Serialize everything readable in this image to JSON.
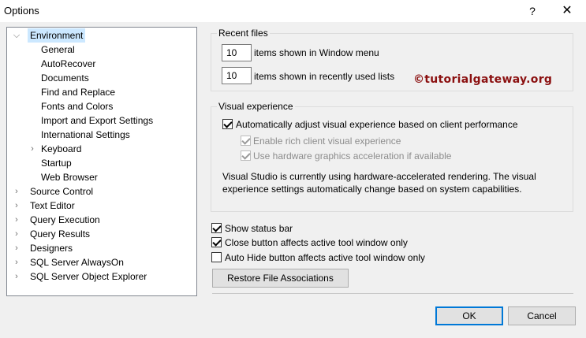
{
  "window": {
    "title": "Options",
    "help_glyph": "?",
    "close_glyph": "✕"
  },
  "tree": {
    "items": [
      {
        "label": "Environment",
        "arrow": "⌵"
      },
      {
        "label": "General"
      },
      {
        "label": "AutoRecover"
      },
      {
        "label": "Documents"
      },
      {
        "label": "Find and Replace"
      },
      {
        "label": "Fonts and Colors"
      },
      {
        "label": "Import and Export Settings"
      },
      {
        "label": "International Settings"
      },
      {
        "label": "Keyboard",
        "arrow": "›"
      },
      {
        "label": "Startup"
      },
      {
        "label": "Web Browser"
      },
      {
        "label": "Source Control",
        "arrow": "›"
      },
      {
        "label": "Text Editor",
        "arrow": "›"
      },
      {
        "label": "Query Execution",
        "arrow": "›"
      },
      {
        "label": "Query Results",
        "arrow": "›"
      },
      {
        "label": "Designers",
        "arrow": "›"
      },
      {
        "label": "SQL Server AlwaysOn",
        "arrow": "›"
      },
      {
        "label": "SQL Server Object Explorer",
        "arrow": "›"
      }
    ]
  },
  "recent_files": {
    "title": "Recent files",
    "window_menu_value": "10",
    "window_menu_label": "items shown in Window menu",
    "recent_lists_value": "10",
    "recent_lists_label": "items shown in recently used lists"
  },
  "watermark": "©tutorialgateway.org",
  "visual_experience": {
    "title": "Visual experience",
    "auto_adjust_label": "Automatically adjust visual experience based on client performance",
    "auto_adjust_checked": true,
    "rich_client_label": "Enable rich client visual experience",
    "rich_client_checked": true,
    "hw_accel_label": "Use hardware graphics acceleration if available",
    "hw_accel_checked": true,
    "info_line1": "Visual Studio is currently using hardware-accelerated rendering. The visual",
    "info_line2": "experience settings automatically change based on system capabilities."
  },
  "options": {
    "status_bar_label": "Show status bar",
    "status_bar_checked": true,
    "close_button_label": "Close button affects active tool window only",
    "close_button_checked": true,
    "auto_hide_label": "Auto Hide button affects active tool window only",
    "auto_hide_checked": false,
    "restore_label": "Restore File Associations"
  },
  "footer": {
    "ok_label": "OK",
    "cancel_label": "Cancel"
  },
  "colors": {
    "selected_bg": "#cce8ff",
    "default_button_border": "#0078d7",
    "watermark": "#8b1010"
  }
}
